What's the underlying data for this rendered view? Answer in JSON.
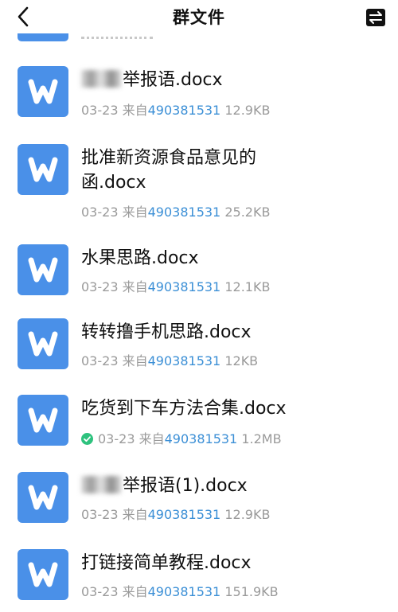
{
  "header": {
    "title": "群文件"
  },
  "colors": {
    "icon_blue": "#4a90e8",
    "sender_blue": "#3b8fd6",
    "meta_gray": "#9a9a9a",
    "check_green": "#2ec27e"
  },
  "files": [
    {
      "name": "举报语.docx",
      "date": "03-23",
      "from_label": "来自",
      "sender": "490381531",
      "size": "12.9KB"
    },
    {
      "name_line1": "批准新资源食品意见的",
      "name_line2": "函.docx",
      "date": "03-23",
      "from_label": "来自",
      "sender": "490381531",
      "size": "25.2KB"
    },
    {
      "name": "水果思路.docx",
      "date": "03-23",
      "from_label": "来自",
      "sender": "490381531",
      "size": "12.1KB"
    },
    {
      "name": "转转撸手机思路.docx",
      "date": "03-23",
      "from_label": "来自",
      "sender": "490381531",
      "size": "12KB"
    },
    {
      "name": "吃货到下车方法合集.docx",
      "date": "03-23",
      "from_label": "来自",
      "sender": "490381531",
      "size": "1.2MB",
      "downloaded": true
    },
    {
      "name": "举报语(1).docx",
      "date": "03-23",
      "from_label": "来自",
      "sender": "490381531",
      "size": "12.9KB"
    },
    {
      "name": "打链接简单教程.docx",
      "date": "03-23",
      "from_label": "来自",
      "sender": "490381531",
      "size": "151.9KB"
    }
  ],
  "icons": {
    "back": "chevron-left-icon",
    "swap": "swap-arrows-icon",
    "file": "word-doc-icon",
    "downloaded": "check-circle-icon"
  }
}
